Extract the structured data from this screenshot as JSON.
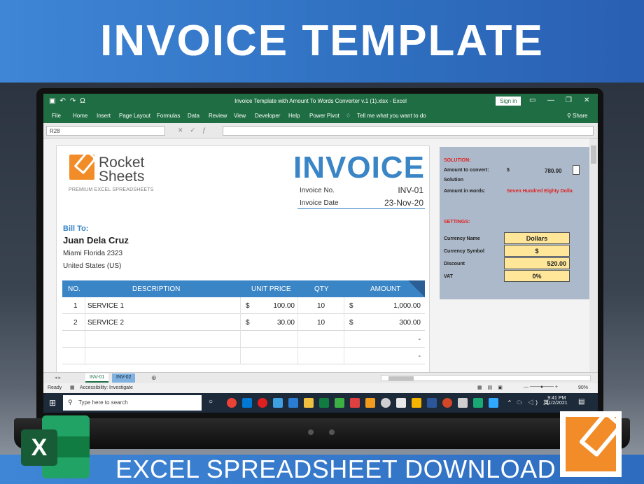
{
  "banner": {
    "top": "INVOICE TEMPLATE",
    "bottom": "EXCEL SPREADSHEET DOWNLOAD"
  },
  "window": {
    "title": "Invoice Template with Amount To Words Converter v.1 (1).xlsx  -  Excel",
    "signin": "Sign in",
    "share": "Share"
  },
  "menu": [
    "File",
    "Home",
    "Insert",
    "Page Layout",
    "Formulas",
    "Data",
    "Review",
    "View",
    "Developer",
    "Help",
    "Power Pivot",
    "Tell me what you want to do"
  ],
  "namebox": "R28",
  "invoice": {
    "brand_line1": "Rocket",
    "brand_line2": "Sheets",
    "tagline": "PREMIUM EXCEL SPREADSHEETS",
    "title": "INVOICE",
    "number_label": "Invoice No.",
    "number_value": "INV-01",
    "date_label": "Invoice Date",
    "date_value": "23-Nov-20",
    "bill_to": "Bill To:",
    "client": "Juan Dela Cruz",
    "address1": "Miami Florida 2323",
    "address2": "United States (US)",
    "headers": {
      "no": "NO.",
      "desc": "DESCRIPTION",
      "price": "UNIT PRICE",
      "qty": "QTY",
      "amount": "AMOUNT"
    },
    "rows": [
      {
        "no": "1",
        "desc": "SERVICE 1",
        "cur": "$",
        "price": "100.00",
        "qty": "10",
        "cur2": "$",
        "amount": "1,000.00"
      },
      {
        "no": "2",
        "desc": "SERVICE 2",
        "cur": "$",
        "price": "30.00",
        "qty": "10",
        "cur2": "$",
        "amount": "300.00"
      },
      {
        "no": "",
        "desc": "",
        "cur": "",
        "price": "",
        "qty": "",
        "cur2": "",
        "amount": "-"
      },
      {
        "no": "",
        "desc": "",
        "cur": "",
        "price": "",
        "qty": "",
        "cur2": "",
        "amount": "-"
      }
    ]
  },
  "panel": {
    "solution_label": "SOLUTION:",
    "amount_convert_label": "Amount to convert:",
    "amount_cur": "$",
    "amount_value": "780.00",
    "solution_sub": "Solution",
    "words_label": "Amount in words:",
    "words_value": "Seven Hundred Eighty Dolla",
    "settings_label": "SETTINGS:",
    "settings": [
      {
        "label": "Currency Name",
        "value": "Dollars"
      },
      {
        "label": "Currency Symbol",
        "value": "$"
      },
      {
        "label": "Discount",
        "value": "520.00"
      },
      {
        "label": "VAT",
        "value": "0%"
      }
    ]
  },
  "tabs": [
    "INV-01",
    "INV-02"
  ],
  "status": {
    "ready": "Ready",
    "accessibility": "Accessibility: Investigate",
    "zoom": "90%"
  },
  "taskbar": {
    "search_placeholder": "Type here to search",
    "time": "9:41 PM",
    "date": "11/2/2021"
  },
  "colors": {
    "excel_green": "#1f6e43",
    "invoice_blue": "#3a85c6",
    "panel_bg": "#acb9ca",
    "setting_yellow": "#ffe699"
  }
}
